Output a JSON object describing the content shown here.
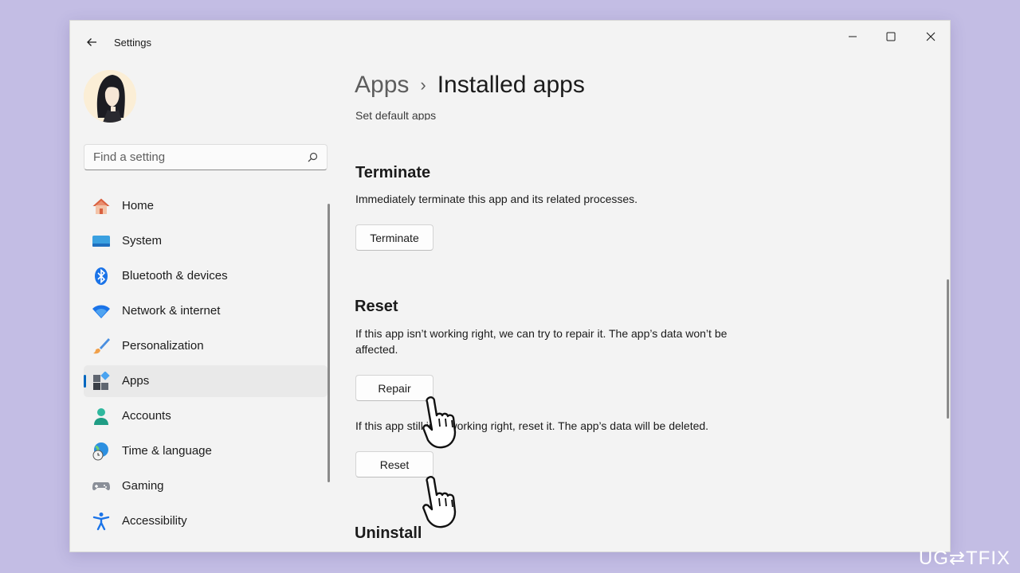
{
  "window": {
    "title": "Settings",
    "controls": [
      "minimize",
      "maximize",
      "close"
    ]
  },
  "search": {
    "placeholder": "Find a setting",
    "value": ""
  },
  "nav": {
    "items": [
      {
        "label": "Home",
        "icon": "home-icon",
        "active": false
      },
      {
        "label": "System",
        "icon": "system-icon",
        "active": false
      },
      {
        "label": "Bluetooth & devices",
        "icon": "bluetooth-icon",
        "active": false
      },
      {
        "label": "Network & internet",
        "icon": "wifi-icon",
        "active": false
      },
      {
        "label": "Personalization",
        "icon": "brush-icon",
        "active": false
      },
      {
        "label": "Apps",
        "icon": "apps-icon",
        "active": true
      },
      {
        "label": "Accounts",
        "icon": "account-icon",
        "active": false
      },
      {
        "label": "Time & language",
        "icon": "globe-clock-icon",
        "active": false
      },
      {
        "label": "Gaming",
        "icon": "gamepad-icon",
        "active": false
      },
      {
        "label": "Accessibility",
        "icon": "accessibility-icon",
        "active": false
      }
    ]
  },
  "breadcrumb": {
    "parent": "Apps",
    "separator": "›",
    "current": "Installed apps"
  },
  "content": {
    "cut_link": "Set default apps",
    "terminate": {
      "title": "Terminate",
      "description": "Immediately terminate this app and its related processes.",
      "button": "Terminate"
    },
    "reset": {
      "title": "Reset",
      "repair_description": "If this app isn’t working right, we can try to repair it. The app’s data won’t be affected.",
      "repair_button": "Repair",
      "reset_description": "If this app still isn’t working right, reset it. The app’s data will be deleted.",
      "reset_button": "Reset"
    },
    "uninstall": {
      "title": "Uninstall"
    }
  },
  "watermark": "UG⇄TFIX",
  "colors": {
    "accent": "#0067c0",
    "background": "#c3bde4",
    "window": "#f3f3f3"
  }
}
